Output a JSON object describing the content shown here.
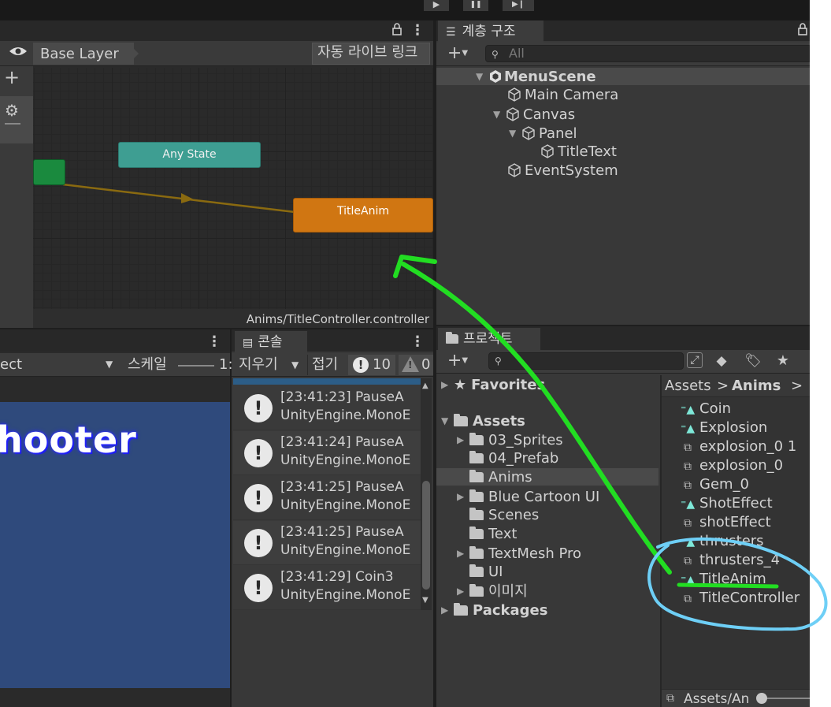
{
  "top": {
    "play": "▶",
    "pause": "❚❚",
    "step": "▶❙"
  },
  "animator": {
    "layer_name": "Base Layer",
    "auto_live_link": "자동 라이브 링크",
    "path": "Anims/TitleController.controller",
    "states": {
      "any_state": "Any State",
      "title_anim": "TitleAnim"
    },
    "colors": {
      "entry": "#1a8a3e",
      "any_state": "#3e9e92",
      "default_state": "#d07612",
      "transition": "#8a6a10"
    }
  },
  "hierarchy": {
    "tab": "계층 구조",
    "search_placeholder": "All",
    "items": [
      {
        "label": "MenuScene"
      },
      {
        "label": "Main Camera"
      },
      {
        "label": "Canvas"
      },
      {
        "label": "Panel"
      },
      {
        "label": "TitleText"
      },
      {
        "label": "EventSystem"
      }
    ]
  },
  "game": {
    "display": "ect",
    "scale_label": "스케일",
    "scale_value": "1:",
    "title_text": "hooter",
    "bg_color": "#2f4a7c"
  },
  "console": {
    "tab": "콘솔",
    "clear": "지우기",
    "collapse": "접기",
    "info_count": "10",
    "warn_count": "0",
    "entries": [
      {
        "line1": "[23:41:23] PauseA",
        "line2": "UnityEngine.MonoE"
      },
      {
        "line1": "[23:41:24] PauseA",
        "line2": "UnityEngine.MonoE"
      },
      {
        "line1": "[23:41:25] PauseA",
        "line2": "UnityEngine.MonoE"
      },
      {
        "line1": "[23:41:25] PauseA",
        "line2": "UnityEngine.MonoE"
      },
      {
        "line1": "[23:41:29] Coin3",
        "line2": "UnityEngine.MonoE"
      }
    ]
  },
  "project": {
    "tab": "프로젝트",
    "favorites": "Favorites",
    "assets_root": "Assets",
    "folders": [
      {
        "label": "03_Sprites"
      },
      {
        "label": "04_Prefab"
      },
      {
        "label": "Anims"
      },
      {
        "label": "Blue Cartoon UI"
      },
      {
        "label": "Scenes"
      },
      {
        "label": "Text"
      },
      {
        "label": "TextMesh Pro"
      },
      {
        "label": "UI"
      },
      {
        "label": "이미지"
      }
    ],
    "packages": "Packages",
    "breadcrumb_root": "Assets",
    "breadcrumb_sep": ">",
    "breadcrumb_current": "Anims",
    "files": [
      {
        "label": "Coin",
        "icon": "anim-clip-icon"
      },
      {
        "label": "Explosion",
        "icon": "anim-clip-icon"
      },
      {
        "label": "explosion_0 1",
        "icon": "animator-controller-icon"
      },
      {
        "label": "explosion_0",
        "icon": "animator-controller-icon"
      },
      {
        "label": "Gem_0",
        "icon": "animator-controller-icon"
      },
      {
        "label": "ShotEffect",
        "icon": "anim-clip-icon"
      },
      {
        "label": "shotEffect",
        "icon": "animator-controller-icon"
      },
      {
        "label": "thrusters",
        "icon": "anim-clip-icon"
      },
      {
        "label": "thrusters_4",
        "icon": "animator-controller-icon"
      },
      {
        "label": "TitleAnim",
        "icon": "anim-clip-icon"
      },
      {
        "label": "TitleController",
        "icon": "animator-controller-icon"
      }
    ],
    "footer_path": "Assets/An"
  },
  "annotation": {
    "arrow_color": "#22dd22",
    "circle_color": "#6ecff6"
  }
}
